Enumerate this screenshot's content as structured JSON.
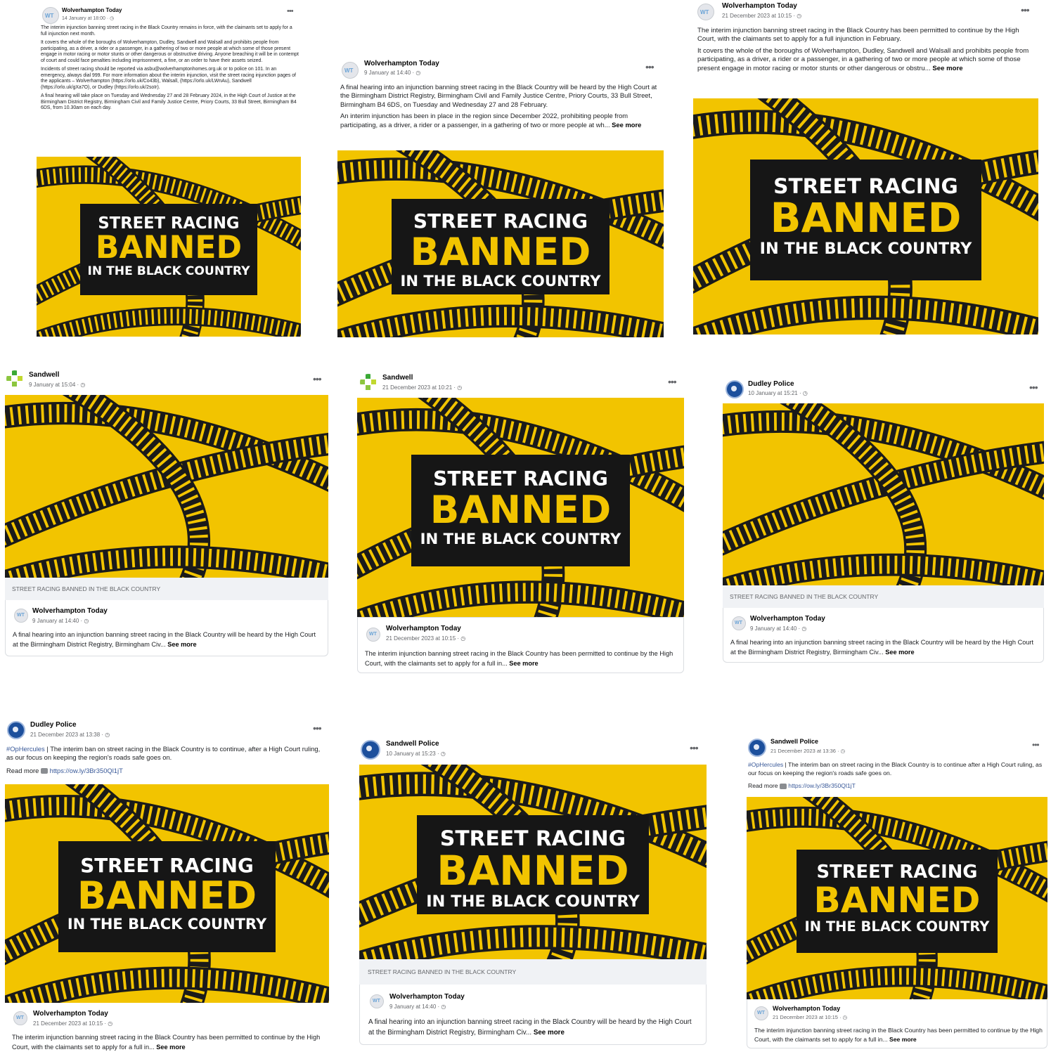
{
  "image_banner": {
    "line1": "STREET RACING",
    "line2": "BANNED",
    "line3": "IN THE BLACK COUNTRY",
    "colors": {
      "yellow": "#f2c400",
      "black": "#161616",
      "tyre": "#1a1a1a"
    }
  },
  "link_caption": "STREET RACING BANNED IN THE BLACK COUNTRY",
  "globe_icon": "globe-icon",
  "more_icon": "more-horizontal-icon",
  "link_icon": "link-icon",
  "posts": [
    {
      "author": "Wolverhampton Today",
      "date": "14 January at 18:00 · ",
      "paragraphs": [
        "The interim injunction banning street racing in the Black Country remains in force, with the claimants set to apply for a full injunction next month.",
        "It covers the whole of the boroughs of Wolverhampton, Dudley, Sandwell and Walsall and prohibits people from participating, as a driver, a rider or a passenger, in a gathering of two or more people at which some of those present engage in motor racing or motor stunts or other dangerous or obstructive driving. Anyone breaching it will be in contempt of court and could face penalties including imprisonment, a fine, or an order to have their assets seized.",
        "Incidents of street racing should be reported via asbu@wolverhamptonhomes.org.uk or to police on 101. In an emergency, always dial 999. For more information about the interim injunction, visit the street racing injunction pages of the applicants – Wolverhampton (https://orlo.uk/Co43b), Walsall, (https://orlo.uk/LWnAu), Sandwell (https://orlo.uk/gXa7O), or Dudley (https://orlo.uk/2soIr).",
        "A final hearing will take place on Tuesday and Wednesday 27 and 28 February 2024, in the High Court of Justice at the Birmingham District Registry, Birmingham Civil and Family Justice Centre, Priory Courts, 33 Bull Street, Birmingham B4 6DS, from 10.30am on each day."
      ]
    },
    {
      "author": "Wolverhampton Today",
      "date": "9 January at 14:40 · ",
      "paragraphs": [
        "A final hearing into an injunction banning street racing in the Black Country will be heard by the High Court at the Birmingham District Registry, Birmingham Civil and Family Justice Centre, Priory Courts, 33 Bull Street, Birmingham B4 6DS, on Tuesday and Wednesday 27 and 28 February.",
        "An interim injunction has been in place in the region since December 2022, prohibiting people from participating, as a driver, a rider or a passenger, in a gathering of two or more people at wh... "
      ],
      "see_more": "See more"
    },
    {
      "author": "Wolverhampton Today",
      "date": "21 December 2023 at 10:15 · ",
      "paragraphs": [
        "The interim injunction banning street racing in the Black Country has been permitted to continue by the High Court, with the claimants set to apply for a full injunction in February.",
        "It covers the whole of the boroughs of Wolverhampton, Dudley, Sandwell and Walsall and prohibits people from participating, as a driver, a rider or a passenger, in a gathering of two or more people at which some of those present engage in motor racing or motor stunts or other dangerous or obstru... "
      ],
      "see_more": "See more"
    },
    {
      "author": "Sandwell",
      "date": "9 January at 15:04 · ",
      "shared": {
        "author": "Wolverhampton Today",
        "date": "9 January at 14:40 · ",
        "text": "A final hearing into an injunction banning street racing in the Black Country will be heard by the High Court at the Birmingham District Registry, Birmingham Civ... ",
        "see_more": "See more"
      }
    },
    {
      "author": "Sandwell",
      "date": "21 December 2023 at 10:21 · ",
      "shared": {
        "author": "Wolverhampton Today",
        "date": "21 December 2023 at 10:15 · ",
        "text": "The interim injunction banning street racing in the Black Country has been permitted to continue by the High Court, with the claimants set to apply for a full in... ",
        "see_more": "See more"
      }
    },
    {
      "author": "Dudley Police",
      "date": "10 January at 15:21 · ",
      "shared": {
        "author": "Wolverhampton Today",
        "date": "9 January at 14:40 · ",
        "text": "A final hearing into an injunction banning street racing in the Black Country will be heard by the High Court at the Birmingham District Registry, Birmingham Civ... ",
        "see_more": "See more"
      }
    },
    {
      "author": "Dudley Police",
      "date": "21 December 2023 at 13:38 · ",
      "hashtag": "#OpHercules",
      "text": " | The interim ban on street racing in the Black Country is to continue, after a High Court ruling, as our focus on keeping the region's roads safe goes on.",
      "read_more": "Read more",
      "link": "https://ow.ly/3Br350Ql1jT",
      "shared": {
        "author": "Wolverhampton Today",
        "date": "21 December 2023 at 10:15 · ",
        "text": "The interim injunction banning street racing in the Black Country has been permitted to continue by the High Court, with the claimants set to apply for a full in... ",
        "see_more": "See more"
      }
    },
    {
      "author": "Sandwell Police",
      "date": "10 January at 15:23 · ",
      "shared": {
        "author": "Wolverhampton Today",
        "date": "9 January at 14:40 · ",
        "text": "A final hearing into an injunction banning street racing in the Black Country will be heard by the High Court at the Birmingham District Registry, Birmingham Civ... ",
        "see_more": "See more"
      }
    },
    {
      "author": "Sandwell Police",
      "date": "21 December 2023 at 13:36 · ",
      "hashtag": "#OpHercules",
      "text": " | The interim ban on street racing in the Black Country is to continue after a High Court ruling, as our focus on keeping the region's roads safe goes on.",
      "read_more": "Read more",
      "link": "https://ow.ly/3Br350Ql1jT",
      "shared": {
        "author": "Wolverhampton Today",
        "date": "21 December 2023 at 10:15 · ",
        "text": "The interim injunction banning street racing in the Black Country has been permitted to continue by the High Court, with the claimants set to apply for a full in... ",
        "see_more": "See more"
      }
    }
  ]
}
